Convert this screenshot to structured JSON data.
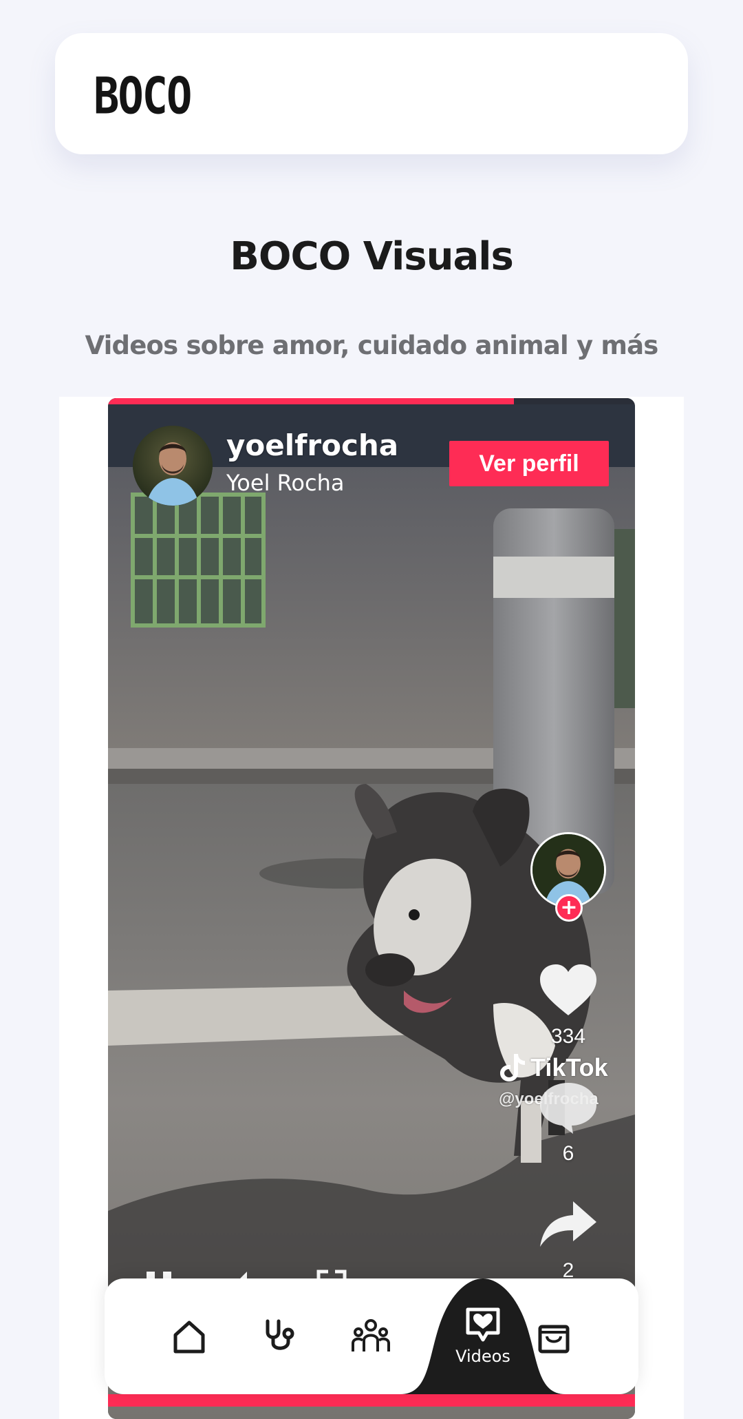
{
  "header": {
    "logo": "BOCO"
  },
  "section": {
    "title": "BOCO Visuals",
    "subtitle": "Videos sobre amor, cuidado animal y más"
  },
  "video": {
    "progress": 0.77,
    "username": "yoelfrocha",
    "display_name": "Yoel Rocha",
    "profile_button": "Ver perfil",
    "follow_symbol": "+",
    "likes": "334",
    "comments": "6",
    "shares": "2",
    "watermark_brand": "TikTok",
    "watermark_handle": "@yoelfrocha",
    "accent_color": "#fe2c55"
  },
  "nav": {
    "items": [
      {
        "icon": "home-icon",
        "label": ""
      },
      {
        "icon": "stethoscope-icon",
        "label": ""
      },
      {
        "icon": "community-icon",
        "label": ""
      },
      {
        "icon": "chat-heart-icon",
        "label": "Videos",
        "active": true
      },
      {
        "icon": "shopping-bag-icon",
        "label": ""
      }
    ],
    "active_label": "Videos"
  }
}
